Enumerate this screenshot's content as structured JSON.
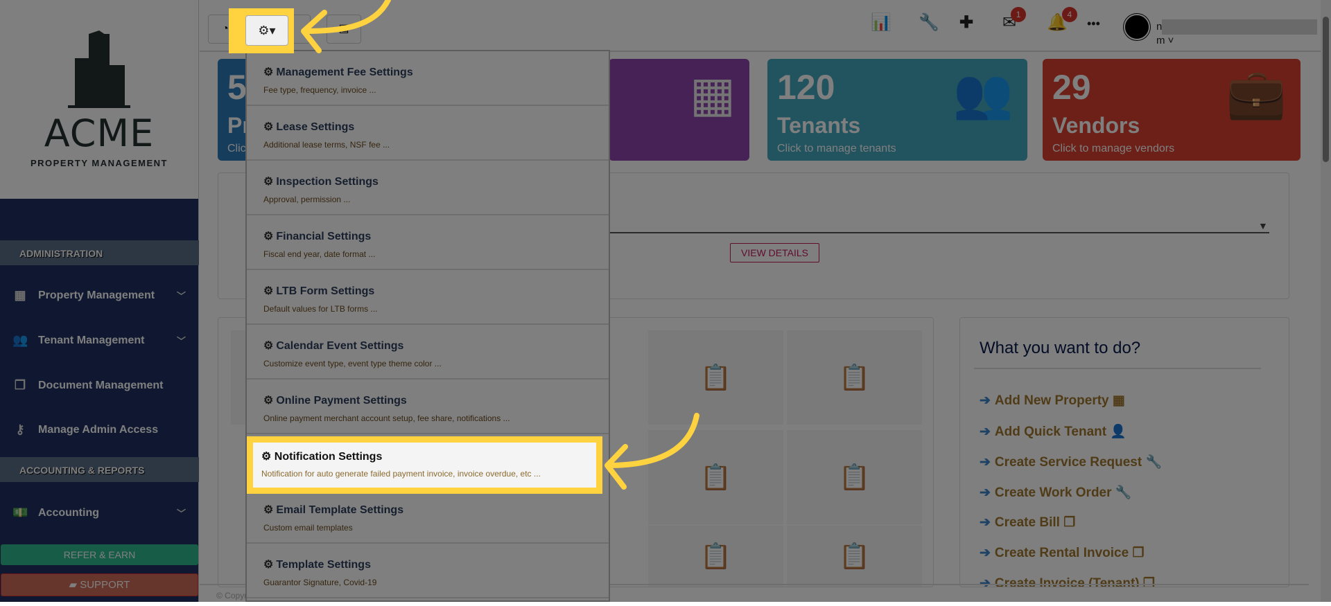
{
  "logo": {
    "word": "ACME",
    "sub": "PROPERTY MANAGEMENT"
  },
  "sidebar": {
    "sections": [
      "ADMINISTRATION",
      "ACCOUNTING & REPORTS"
    ],
    "items": [
      {
        "label": "Property Management"
      },
      {
        "label": "Tenant Management"
      },
      {
        "label": "Document Management"
      },
      {
        "label": "Manage Admin Access"
      },
      {
        "label": "Accounting"
      }
    ],
    "refer": "REFER & EARN",
    "support": "SUPPORT"
  },
  "topbar": {
    "mail_badge": "1",
    "bell_badge": "4",
    "user": "n"
  },
  "cards": [
    {
      "num": "5",
      "label": "Pr",
      "sub": "Clic",
      "color": "#2e7bb8"
    },
    {
      "color": "#8e44ad"
    },
    {
      "num": "120",
      "label": "Tenants",
      "sub": "Click to manage tenants",
      "color": "#45a8c0"
    },
    {
      "num": "29",
      "label": "Vendors",
      "sub": "Click to manage vendors",
      "color": "#d9402f"
    }
  ],
  "view_details": "VIEW DETAILS",
  "todo": {
    "title": "What you want to do?",
    "items": [
      "Add New Property",
      "Add Quick Tenant",
      "Create Service Request",
      "Create Work Order",
      "Create Bill",
      "Create Rental Invoice",
      "Create Invoice (Tenant)"
    ]
  },
  "footer": "© Copyr",
  "dropdown": [
    {
      "t": "Management Fee Settings",
      "d": "Fee type, frequency, invoice ..."
    },
    {
      "t": "Lease Settings",
      "d": "Additional lease terms, NSF fee ..."
    },
    {
      "t": "Inspection Settings",
      "d": "Approval, permission ..."
    },
    {
      "t": "Financial Settings",
      "d": "Fiscal end year, date format ..."
    },
    {
      "t": "LTB Form Settings",
      "d": "Default values for LTB forms ..."
    },
    {
      "t": "Calendar Event Settings",
      "d": "Customize event type, event type theme color ..."
    },
    {
      "t": "Online Payment Settings",
      "d": "Online payment merchant account setup, fee share, notifications ..."
    },
    {
      "t": "Notification Settings",
      "d": "Notification for auto generate failed payment invoice, invoice overdue, etc ..."
    },
    {
      "t": "Email Template Settings",
      "d": "Custom email templates"
    },
    {
      "t": "Template Settings",
      "d": "Guarantor Signature, Covid-19"
    }
  ]
}
